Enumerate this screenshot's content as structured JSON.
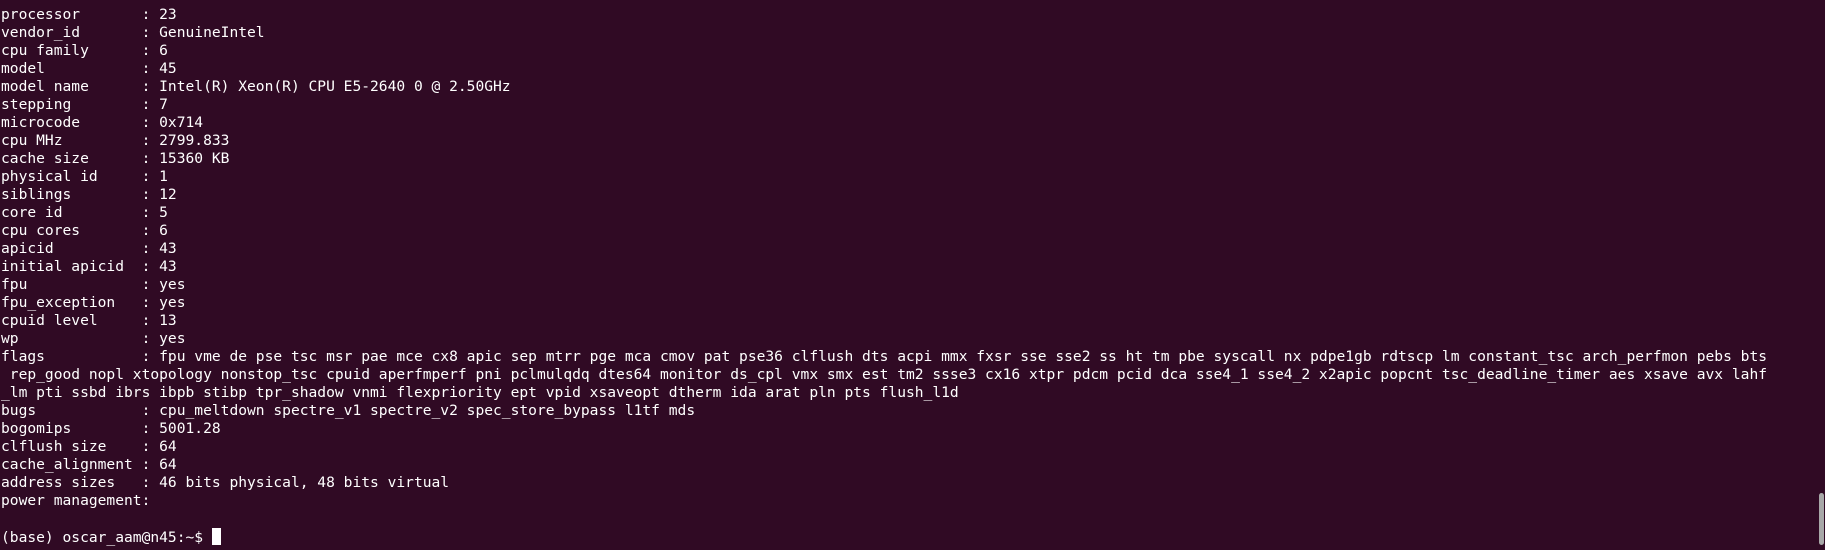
{
  "terminal": {
    "lines": [
      "processor       : 23",
      "vendor_id       : GenuineIntel",
      "cpu family      : 6",
      "model           : 45",
      "model name      : Intel(R) Xeon(R) CPU E5-2640 0 @ 2.50GHz",
      "stepping        : 7",
      "microcode       : 0x714",
      "cpu MHz         : 2799.833",
      "cache size      : 15360 KB",
      "physical id     : 1",
      "siblings        : 12",
      "core id         : 5",
      "cpu cores       : 6",
      "apicid          : 43",
      "initial apicid  : 43",
      "fpu             : yes",
      "fpu_exception   : yes",
      "cpuid level     : 13",
      "wp              : yes",
      "flags           : fpu vme de pse tsc msr pae mce cx8 apic sep mtrr pge mca cmov pat pse36 clflush dts acpi mmx fxsr sse sse2 ss ht tm pbe syscall nx pdpe1gb rdtscp lm constant_tsc arch_perfmon pebs bts",
      " rep_good nopl xtopology nonstop_tsc cpuid aperfmperf pni pclmulqdq dtes64 monitor ds_cpl vmx smx est tm2 ssse3 cx16 xtpr pdcm pcid dca sse4_1 sse4_2 x2apic popcnt tsc_deadline_timer aes xsave avx lahf",
      "_lm pti ssbd ibrs ibpb stibp tpr_shadow vnmi flexpriority ept vpid xsaveopt dtherm ida arat pln pts flush_l1d",
      "bugs            : cpu_meltdown spectre_v1 spectre_v2 spec_store_bypass l1tf mds",
      "bogomips        : 5001.28",
      "clflush size    : 64",
      "cache_alignment : 64",
      "address sizes   : 46 bits physical, 48 bits virtual",
      "power management:"
    ],
    "prompt": "(base) oscar_aam@n45:~$ "
  }
}
